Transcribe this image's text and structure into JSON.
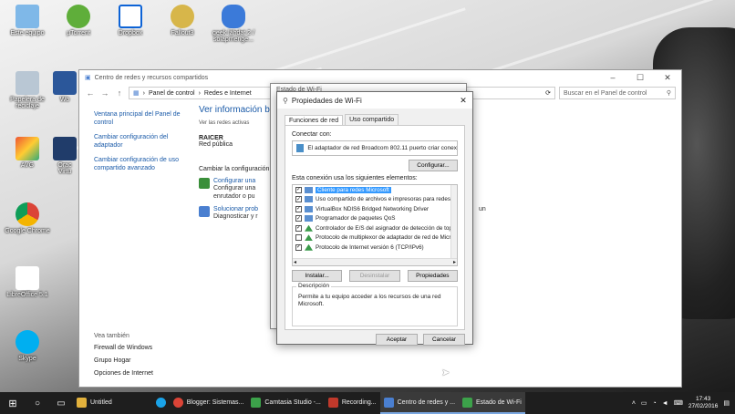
{
  "desktop": {
    "icons": [
      {
        "name": "recycle-bin-icon",
        "label": "Este equipo"
      },
      {
        "name": "utorrent-icon",
        "label": "µTorrent"
      },
      {
        "name": "dropbox-icon",
        "label": "Dropbox"
      },
      {
        "name": "fallout-icon",
        "label": "Fallout3"
      },
      {
        "name": "folder-icon",
        "label": "geek lähdat 2 / solapmenge..."
      },
      {
        "name": "recycle-bin-icon",
        "label": "Papelera de reciclaje"
      },
      {
        "name": "word-icon",
        "label": "Wo"
      },
      {
        "name": "avg-icon",
        "label": "AVG"
      },
      {
        "name": "oracle-vm-icon",
        "label": "Orac Virtu"
      },
      {
        "name": "chrome-icon",
        "label": "Google Chrome"
      },
      {
        "name": "libreoffice-icon",
        "label": "LibreOffice 5.1"
      },
      {
        "name": "skype-icon",
        "label": "Skype"
      }
    ]
  },
  "explorer": {
    "title": "Centro de redes y recursos compartidos",
    "breadcrumb": [
      "Panel de control",
      "Redes e Internet"
    ],
    "search_placeholder": "Buscar en el Panel de control",
    "left_nav": [
      "Ventana principal del Panel de control",
      "Cambiar configuración del adaptador",
      "Cambiar configuración de uso compartido avanzado"
    ],
    "see_also_heading": "Vea también",
    "see_also": [
      "Firewall de Windows",
      "Grupo Hogar",
      "Opciones de Internet"
    ],
    "heading": "Ver información bá",
    "active_networks": "Ver las redes activas",
    "network_name": "RAICER",
    "network_type": "Red pública",
    "change_settings": "Cambiar la configuración",
    "tasks": [
      {
        "title": "Configurar una",
        "desc": "Configurar una\nenrutador o pu"
      },
      {
        "title": "Solucionar prob",
        "desc": "Diagnosticar y r"
      }
    ],
    "right_crop": "un"
  },
  "back_dialog": {
    "title": "Estado de Wi-Fi"
  },
  "dialog": {
    "title": "Propiedades de Wi-Fi",
    "tabs": [
      "Funciones de red",
      "Uso compartido"
    ],
    "connect_label": "Conectar con:",
    "adapter": "El adaptador de red Broadcom 802.11 puerto criar conex",
    "configure": "Configurar...",
    "items_label": "Esta conexión usa los siguientes elementos:",
    "items": [
      {
        "text": "Cliente para redes Microsoft",
        "checked": true,
        "selected": true
      },
      {
        "text": "Uso compartido de archivos e impresoras para redes M",
        "checked": true,
        "selected": false
      },
      {
        "text": "VirtualBox NDIS6 Bridged Networking Driver",
        "checked": true,
        "selected": false
      },
      {
        "text": "Programador de paquetes QoS",
        "checked": true,
        "selected": false
      },
      {
        "text": "Controlador de E/S del asignador de detección de topo",
        "checked": true,
        "selected": false
      },
      {
        "text": "Protocolo de multiplexor de adaptador de red de Micros",
        "checked": false,
        "selected": false
      },
      {
        "text": "Protocolo de Internet versión 6 (TCP/IPv6)",
        "checked": true,
        "selected": false
      }
    ],
    "install": "Instalar...",
    "uninstall": "Desinstalar",
    "properties": "Propiedades",
    "description_label": "Descripción",
    "description": "Permite a tu equipo acceder a los recursos de una red Microsoft.",
    "ok": "Aceptar",
    "cancel": "Cancelar"
  },
  "taskbar": {
    "items": [
      {
        "name": "taskbar-untitled",
        "label": "Untitled",
        "color": "#e2b13c"
      },
      {
        "name": "taskbar-skype",
        "label": "",
        "color": "#1aa3e8"
      },
      {
        "name": "taskbar-chrome",
        "label": "Blogger: Sistemas...",
        "color": "#db4437"
      },
      {
        "name": "taskbar-camtasia",
        "label": "Camtasia Studio -...",
        "color": "#3ca24a"
      },
      {
        "name": "taskbar-recording",
        "label": "Recording...",
        "color": "#c0392b"
      },
      {
        "name": "taskbar-network-center",
        "label": "Centro de redes y ...",
        "color": "#4a7fd0"
      },
      {
        "name": "taskbar-wifi-status",
        "label": "Estado de Wi-Fi",
        "color": "#3ca24a"
      }
    ],
    "time": "17:43",
    "date": "27/02/2016"
  }
}
